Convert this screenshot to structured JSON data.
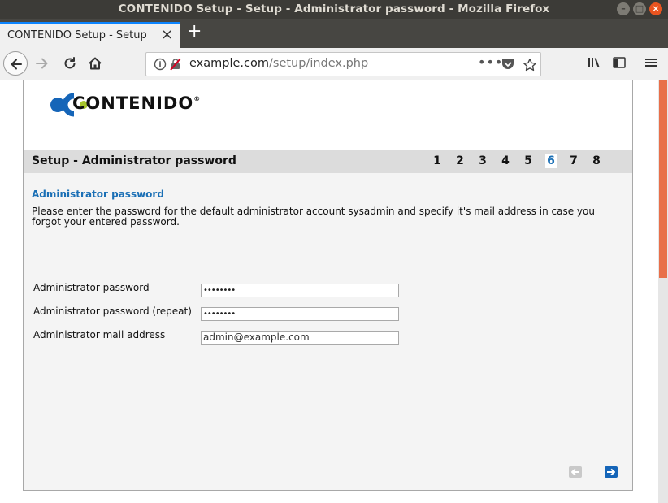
{
  "window": {
    "title": "CONTENIDO Setup - Setup - Administrator password - Mozilla Firefox"
  },
  "tab": {
    "label": "CONTENIDO Setup - Setup - Ad",
    "close": "×",
    "new_tab": "+"
  },
  "urlbar": {
    "domain": "example.com",
    "path": "/setup/index.php",
    "menu_dots": "•••"
  },
  "logo": {
    "text": "CONTENIDO",
    "mark": "®"
  },
  "stepbar": {
    "title": "Setup - Administrator password",
    "steps": [
      "1",
      "2",
      "3",
      "4",
      "5",
      "6",
      "7",
      "8"
    ],
    "active_step": "6"
  },
  "section": {
    "title": "Administrator password",
    "description": "Please enter the password for the default administrator account sysadmin and specify it's mail address in case you forgot your entered password."
  },
  "form": {
    "password_label": "Administrator password",
    "password_value": "••••••••",
    "password_repeat_label": "Administrator password (repeat)",
    "password_repeat_value": "••••••••",
    "mail_label": "Administrator mail address",
    "mail_value": "admin@example.com"
  },
  "colors": {
    "accent": "#1a6fb5",
    "logo_blue": "#1565b8",
    "logo_green": "#a8c62c",
    "scroll_thumb": "#e8704a"
  }
}
